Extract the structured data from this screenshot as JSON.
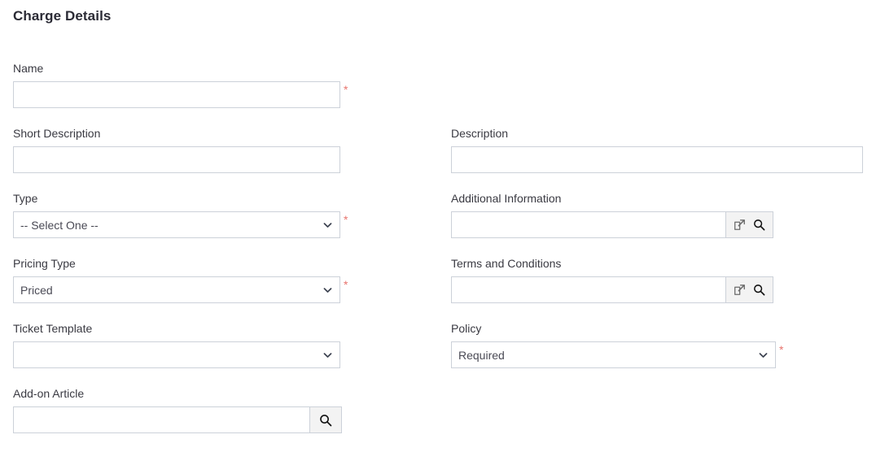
{
  "page": {
    "title": "Charge Details"
  },
  "required_marker": "*",
  "fields": {
    "name": {
      "label": "Name",
      "value": "",
      "placeholder": "",
      "required": true
    },
    "short_description": {
      "label": "Short Description",
      "value": "",
      "placeholder": "",
      "required": false
    },
    "description": {
      "label": "Description",
      "value": "",
      "placeholder": "",
      "required": false
    },
    "type": {
      "label": "Type",
      "selected": "-- Select One --",
      "options": [
        "-- Select One --"
      ],
      "required": true
    },
    "additional_information": {
      "label": "Additional Information",
      "value": "",
      "placeholder": "",
      "required": false,
      "buttons": [
        "external-link-icon",
        "search-icon"
      ]
    },
    "pricing_type": {
      "label": "Pricing Type",
      "selected": "Priced",
      "options": [
        "Priced"
      ],
      "required": true
    },
    "terms_and_conditions": {
      "label": "Terms and Conditions",
      "value": "",
      "placeholder": "",
      "required": false,
      "buttons": [
        "external-link-icon",
        "search-icon"
      ]
    },
    "ticket_template": {
      "label": "Ticket Template",
      "selected": "",
      "options": [
        ""
      ],
      "required": false
    },
    "policy": {
      "label": "Policy",
      "selected": "Required",
      "options": [
        "Required"
      ],
      "required": true
    },
    "addon_article": {
      "label": "Add-on Article",
      "value": "",
      "placeholder": "",
      "required": false,
      "buttons": [
        "search-icon"
      ]
    }
  },
  "colors": {
    "required_star": "#e8736c",
    "border": "#ccd1d9",
    "label_text": "#3a3a42",
    "title_text": "#2b2b35",
    "button_bg": "#f3f3f3"
  }
}
